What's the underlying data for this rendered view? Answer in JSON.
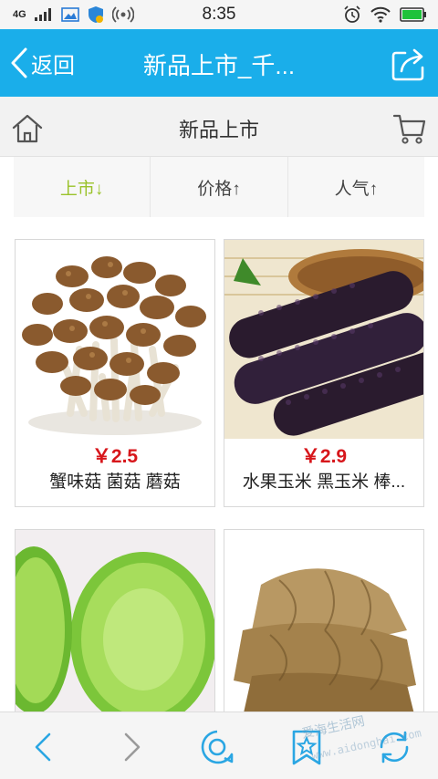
{
  "status_bar": {
    "network": "4G",
    "time": "8:35"
  },
  "title_bar": {
    "back_label": "返回",
    "title": "新品上市_千..."
  },
  "store_header": {
    "title": "新品上市"
  },
  "sort_tabs": [
    {
      "label": "上市↓",
      "active": true
    },
    {
      "label": "价格↑",
      "active": false
    },
    {
      "label": "人气↑",
      "active": false
    }
  ],
  "products": [
    {
      "price": "￥2.5",
      "name": "蟹味菇 菌菇 蘑菇",
      "image": "mushroom-image"
    },
    {
      "price": "￥2.9",
      "name": "水果玉米 黑玉米 棒...",
      "image": "black-corn-image"
    },
    {
      "price": "",
      "name": "",
      "image": "radish-image"
    },
    {
      "price": "",
      "name": "",
      "image": "bamboo-shoot-image"
    }
  ],
  "watermark": {
    "text": "爱海生活网",
    "url": "www.aidonghai.com"
  },
  "colors": {
    "accent": "#1aaeea",
    "active_tab": "#9ac22a",
    "price": "#d7161b"
  }
}
